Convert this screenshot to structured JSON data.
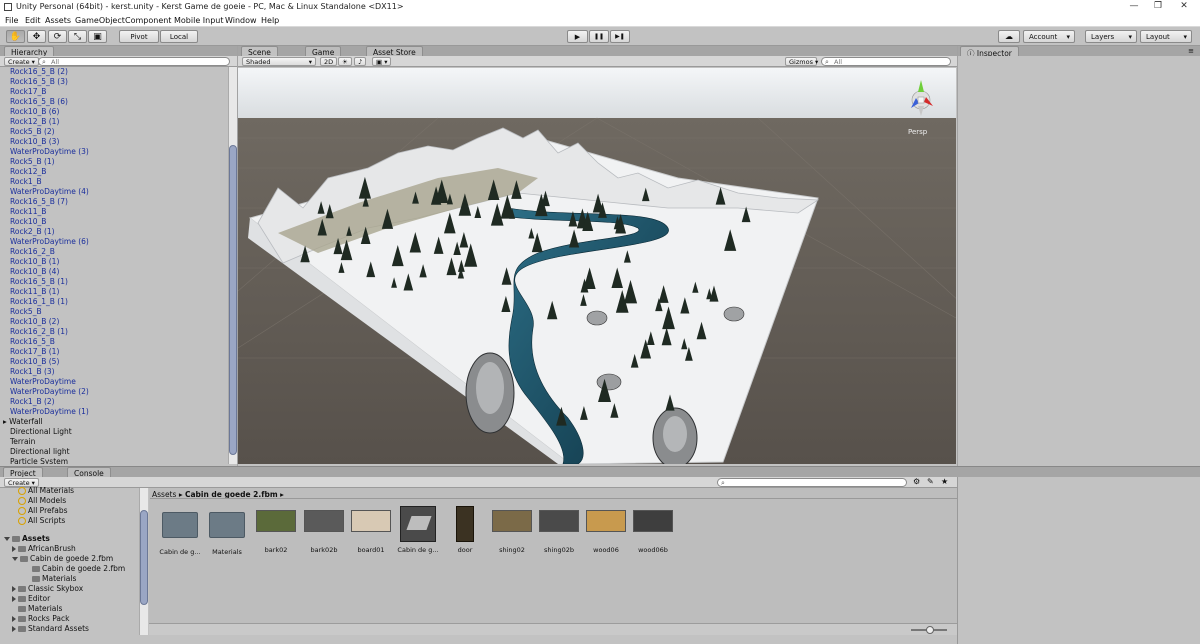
{
  "window": {
    "title": "Unity Personal (64bit) - kerst.unity - Kerst Game de goeie - PC, Mac & Linux Standalone <DX11>",
    "minimize": "—",
    "maximize": "❐",
    "close": "✕"
  },
  "menu": [
    "File",
    "Edit",
    "Assets",
    "GameObject",
    "Component",
    "Mobile Input",
    "Window",
    "Help"
  ],
  "toolbar": {
    "pivot": "Pivot",
    "local": "Local",
    "play": "▶",
    "pause": "❚❚",
    "step": "▶❚",
    "account": "Account",
    "layers": "Layers",
    "layout": "Layout",
    "tools": [
      "✋",
      "✥",
      "⟳",
      "⤡",
      "▣"
    ]
  },
  "hierarchy": {
    "tab": "Hierarchy",
    "create": "Create",
    "search_placeholder": "All",
    "items": [
      {
        "label": "Rock16_5_B (2)",
        "prefab": true
      },
      {
        "label": "Rock16_5_B (3)",
        "prefab": true
      },
      {
        "label": "Rock17_B",
        "prefab": true
      },
      {
        "label": "Rock16_5_B (6)",
        "prefab": true
      },
      {
        "label": "Rock10_B (6)",
        "prefab": true
      },
      {
        "label": "Rock12_B (1)",
        "prefab": true
      },
      {
        "label": "Rock5_B (2)",
        "prefab": true
      },
      {
        "label": "Rock10_B (3)",
        "prefab": true
      },
      {
        "label": "WaterProDaytime (3)",
        "prefab": true
      },
      {
        "label": "Rock5_B (1)",
        "prefab": true
      },
      {
        "label": "Rock12_B",
        "prefab": true
      },
      {
        "label": "Rock1_B",
        "prefab": true
      },
      {
        "label": "WaterProDaytime (4)",
        "prefab": true
      },
      {
        "label": "Rock16_5_B (7)",
        "prefab": true
      },
      {
        "label": "Rock11_B",
        "prefab": true
      },
      {
        "label": "Rock10_B",
        "prefab": true
      },
      {
        "label": "Rock2_B (1)",
        "prefab": true
      },
      {
        "label": "WaterProDaytime (6)",
        "prefab": true
      },
      {
        "label": "Rock16_2_B",
        "prefab": true
      },
      {
        "label": "Rock10_B (1)",
        "prefab": true
      },
      {
        "label": "Rock10_B (4)",
        "prefab": true
      },
      {
        "label": "Rock16_5_B (1)",
        "prefab": true
      },
      {
        "label": "Rock11_B (1)",
        "prefab": true
      },
      {
        "label": "Rock16_1_B (1)",
        "prefab": true
      },
      {
        "label": "Rock5_B",
        "prefab": true
      },
      {
        "label": "Rock10_B (2)",
        "prefab": true
      },
      {
        "label": "Rock16_2_B (1)",
        "prefab": true
      },
      {
        "label": "Rock16_5_B",
        "prefab": true
      },
      {
        "label": "Rock17_B (1)",
        "prefab": true
      },
      {
        "label": "Rock10_B (5)",
        "prefab": true
      },
      {
        "label": "Rock1_B (3)",
        "prefab": true
      },
      {
        "label": "WaterProDaytime",
        "prefab": true
      },
      {
        "label": "WaterProDaytime (2)",
        "prefab": true
      },
      {
        "label": "Rock1_B (2)",
        "prefab": true
      },
      {
        "label": "WaterProDaytime (1)",
        "prefab": true
      },
      {
        "label": "Waterfall",
        "prefab": false,
        "expandable": true
      },
      {
        "label": "Directional Light",
        "prefab": false
      },
      {
        "label": "Terrain",
        "prefab": false
      },
      {
        "label": "Directional light",
        "prefab": false
      },
      {
        "label": "Particle System",
        "prefab": false
      }
    ]
  },
  "scene": {
    "tabs": [
      "Scene",
      "Game",
      "Asset Store"
    ],
    "shading": "Shaded",
    "mode2d": "2D",
    "gizmos": "Gizmos",
    "search_placeholder": "All",
    "persp": "Persp"
  },
  "inspector": {
    "tab": "Inspector"
  },
  "project": {
    "tabs": [
      "Project",
      "Console"
    ],
    "create": "Create",
    "favorites": [
      "All Materials",
      "All Models",
      "All Prefabs",
      "All Scripts"
    ],
    "assets_root": "Assets",
    "folders": [
      {
        "label": "AfricanBrush",
        "level": 1,
        "state": "closed"
      },
      {
        "label": "Cabin de goede 2.fbm",
        "level": 1,
        "state": "open"
      },
      {
        "label": "Cabin de goede 2.fbm",
        "level": 2,
        "state": "leaf"
      },
      {
        "label": "Materials",
        "level": 2,
        "state": "leaf"
      },
      {
        "label": "Classic Skybox",
        "level": 1,
        "state": "closed"
      },
      {
        "label": "Editor",
        "level": 1,
        "state": "closed"
      },
      {
        "label": "Materials",
        "level": 1,
        "state": "leaf"
      },
      {
        "label": "Rocks Pack",
        "level": 1,
        "state": "closed"
      },
      {
        "label": "Standard Assets",
        "level": 1,
        "state": "closed"
      }
    ],
    "breadcrumb": [
      "Assets",
      "Cabin de goede 2.fbm"
    ],
    "assets": [
      {
        "label": "Cabin de g...",
        "kind": "folder"
      },
      {
        "label": "Materials",
        "kind": "folder"
      },
      {
        "label": "bark02",
        "kind": "tex",
        "color": "#5b6a3a"
      },
      {
        "label": "bark02b",
        "kind": "tex",
        "color": "#5a5a5a"
      },
      {
        "label": "board01",
        "kind": "tex",
        "color": "#d8c9b4"
      },
      {
        "label": "Cabin de g...",
        "kind": "model"
      },
      {
        "label": "door",
        "kind": "door"
      },
      {
        "label": "shing02",
        "kind": "tex",
        "color": "#7b6a48"
      },
      {
        "label": "shing02b",
        "kind": "tex",
        "color": "#4a4a4a"
      },
      {
        "label": "wood06",
        "kind": "tex",
        "color": "#c89a4e"
      },
      {
        "label": "wood06b",
        "kind": "tex",
        "color": "#3e3e3e"
      }
    ]
  }
}
